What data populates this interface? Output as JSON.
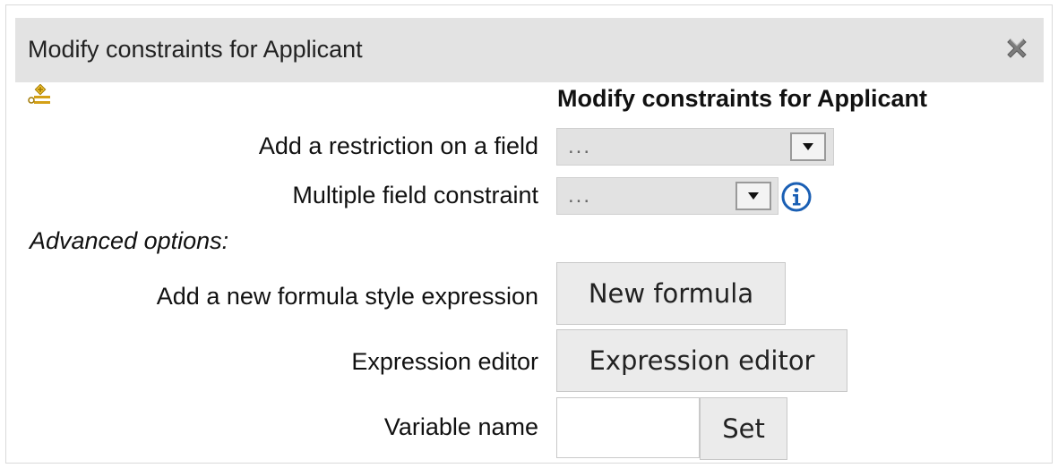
{
  "dialog": {
    "title": "Modify constraints for Applicant",
    "heading": "Modify constraints for Applicant"
  },
  "fields": {
    "restriction_label": "Add a restriction on a field",
    "restriction_value": "...",
    "multiple_label": "Multiple field constraint",
    "multiple_value": "..."
  },
  "advanced": {
    "section_label": "Advanced options:",
    "formula_label": "Add a new formula style expression",
    "formula_button": "New formula",
    "expression_label": "Expression editor",
    "expression_button": "Expression editor",
    "variable_label": "Variable name",
    "variable_value": "",
    "set_button": "Set"
  },
  "icons": {
    "close": "close-icon",
    "fact": "fact-pattern-icon",
    "info": "info-icon",
    "dropdown": "chevron-down-icon"
  },
  "colors": {
    "titlebar": "#e3e3e3",
    "info_blue": "#1a5fb4",
    "icon_gold": "#d4a017"
  }
}
